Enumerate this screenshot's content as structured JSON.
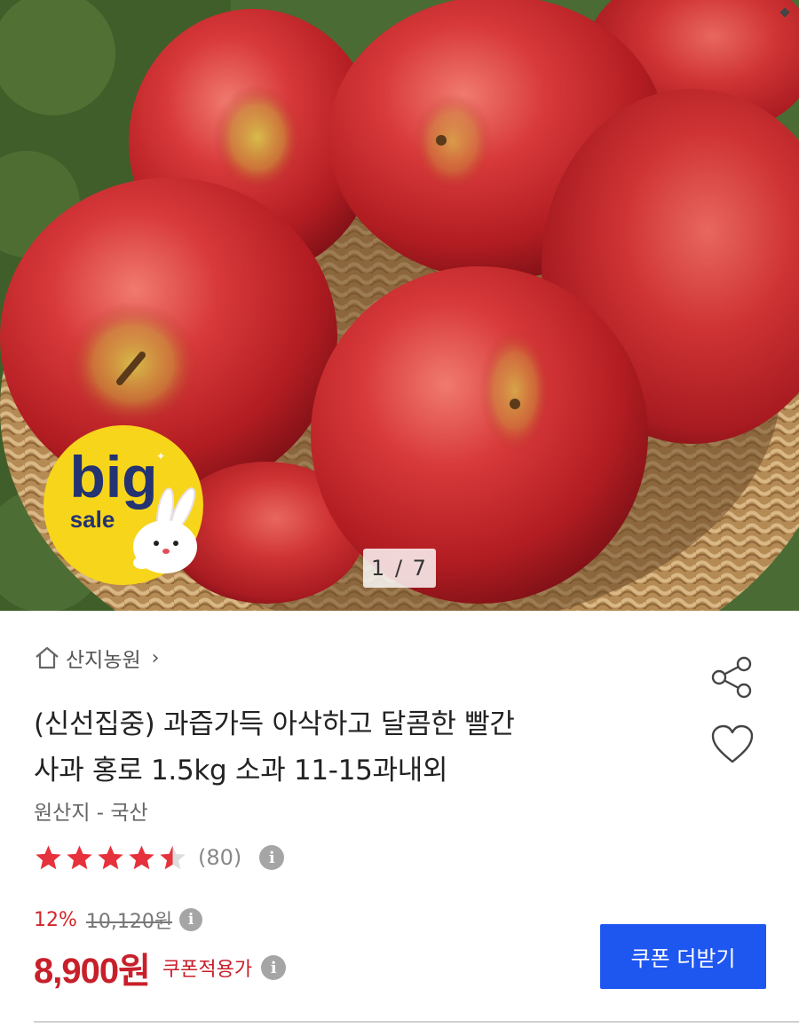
{
  "gallery": {
    "counter": "1 / 7",
    "badge_word_1": "big",
    "badge_word_2": "sale",
    "image_subject": "red apples in a woven basket"
  },
  "seller": {
    "icon": "home-icon",
    "name": "산지농원",
    "chevron": "›"
  },
  "product": {
    "title_line1": "(신선집중) 과즙가득 아삭하고 달콤한 빨간",
    "title_line2": "사과 홍로 1.5kg 소과 11-15과내외",
    "origin": "원산지 - 국산"
  },
  "actions": {
    "share_icon": "share-icon",
    "wishlist_icon": "heart-icon"
  },
  "rating": {
    "stars": 4.5,
    "max_stars": 5,
    "review_count": "(80)",
    "info_glyph": "i"
  },
  "pricing": {
    "discount_rate": "12%",
    "original_price": "10,120원",
    "sale_price": "8,900원",
    "coupon_note": "쿠폰적용가",
    "info_glyph": "i"
  },
  "coupon_button": {
    "label": "쿠폰 더받기"
  },
  "colors": {
    "accent_blue": "#1e56f0",
    "price_red": "#c8202a",
    "star_red": "#e5323c",
    "badge_yellow": "#f7d51b",
    "badge_navy": "#243371"
  }
}
